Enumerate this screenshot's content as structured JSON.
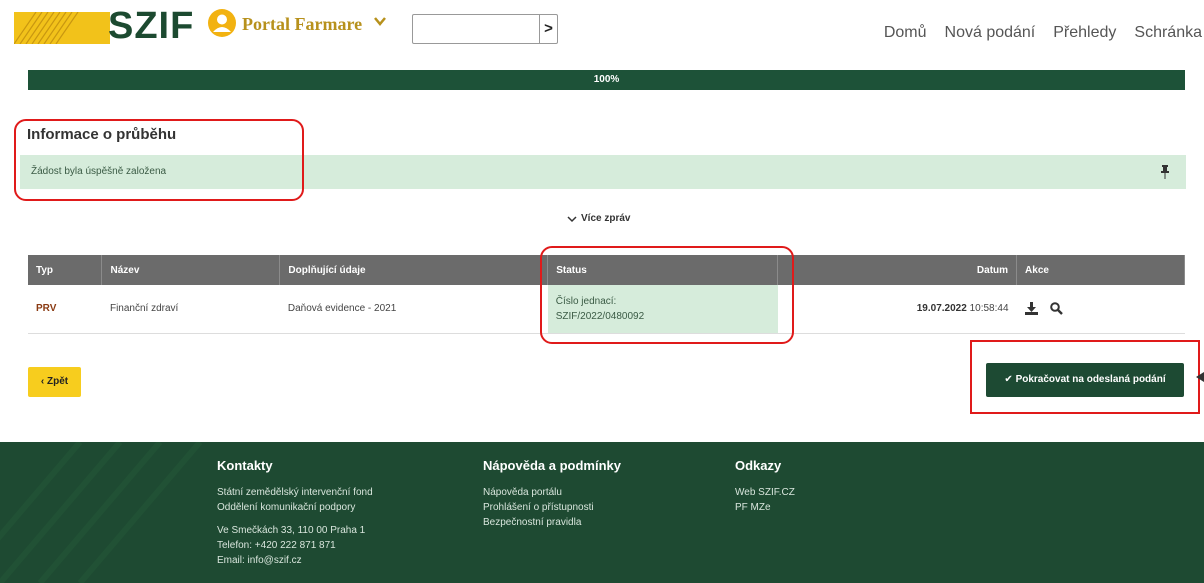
{
  "header": {
    "logo_text": "SZIF",
    "portal_name": "Portal Farmare",
    "search": {
      "value": "",
      "placeholder": ""
    },
    "search_go": ">",
    "nav": [
      "Domů",
      "Nová podání",
      "Přehledy",
      "Schránka"
    ]
  },
  "progress": {
    "percent": 100,
    "label": "100%"
  },
  "info": {
    "title": "Informace o průběhu",
    "message": "Žádost byla úspěšně založena",
    "more_label": "Více zpráv"
  },
  "table": {
    "headers": [
      "Typ",
      "Název",
      "Doplňující údaje",
      "Status",
      "Datum",
      "Akce"
    ],
    "rows": [
      {
        "typ": "PRV",
        "nazev": "Finanční zdraví",
        "doplnujici": "Daňová evidence - 2021",
        "status_line1": "Číslo jednací:",
        "status_line2": "SZIF/2022/0480092",
        "datum_date": "19.07.2022",
        "datum_time": "10:58:44",
        "actions": [
          "download-icon",
          "search-icon"
        ]
      }
    ]
  },
  "buttons": {
    "back": "Zpět",
    "continue": "Pokračovat na odeslaná podání"
  },
  "footer": {
    "contacts": {
      "title": "Kontakty",
      "lines": [
        "Státní zemědělský intervenční fond",
        "Oddělení komunikační podpory"
      ],
      "address": [
        "Ve Smečkách 33, 110 00 Praha 1",
        "Telefon: +420 222 871 871",
        "Email: info@szif.cz"
      ]
    },
    "help": {
      "title": "Nápověda a podmínky",
      "links": [
        "Nápověda portálu",
        "Prohlášení o přístupnosti",
        "Bezpečnostní pravidla"
      ]
    },
    "links": {
      "title": "Odkazy",
      "links": [
        "Web SZIF.CZ",
        "PF MZe"
      ]
    }
  },
  "colors": {
    "brand_green": "#1d4a33",
    "brand_yellow": "#f7cd1e",
    "success_bg": "#d6ecdb",
    "annotation_red": "#e01a1a"
  }
}
